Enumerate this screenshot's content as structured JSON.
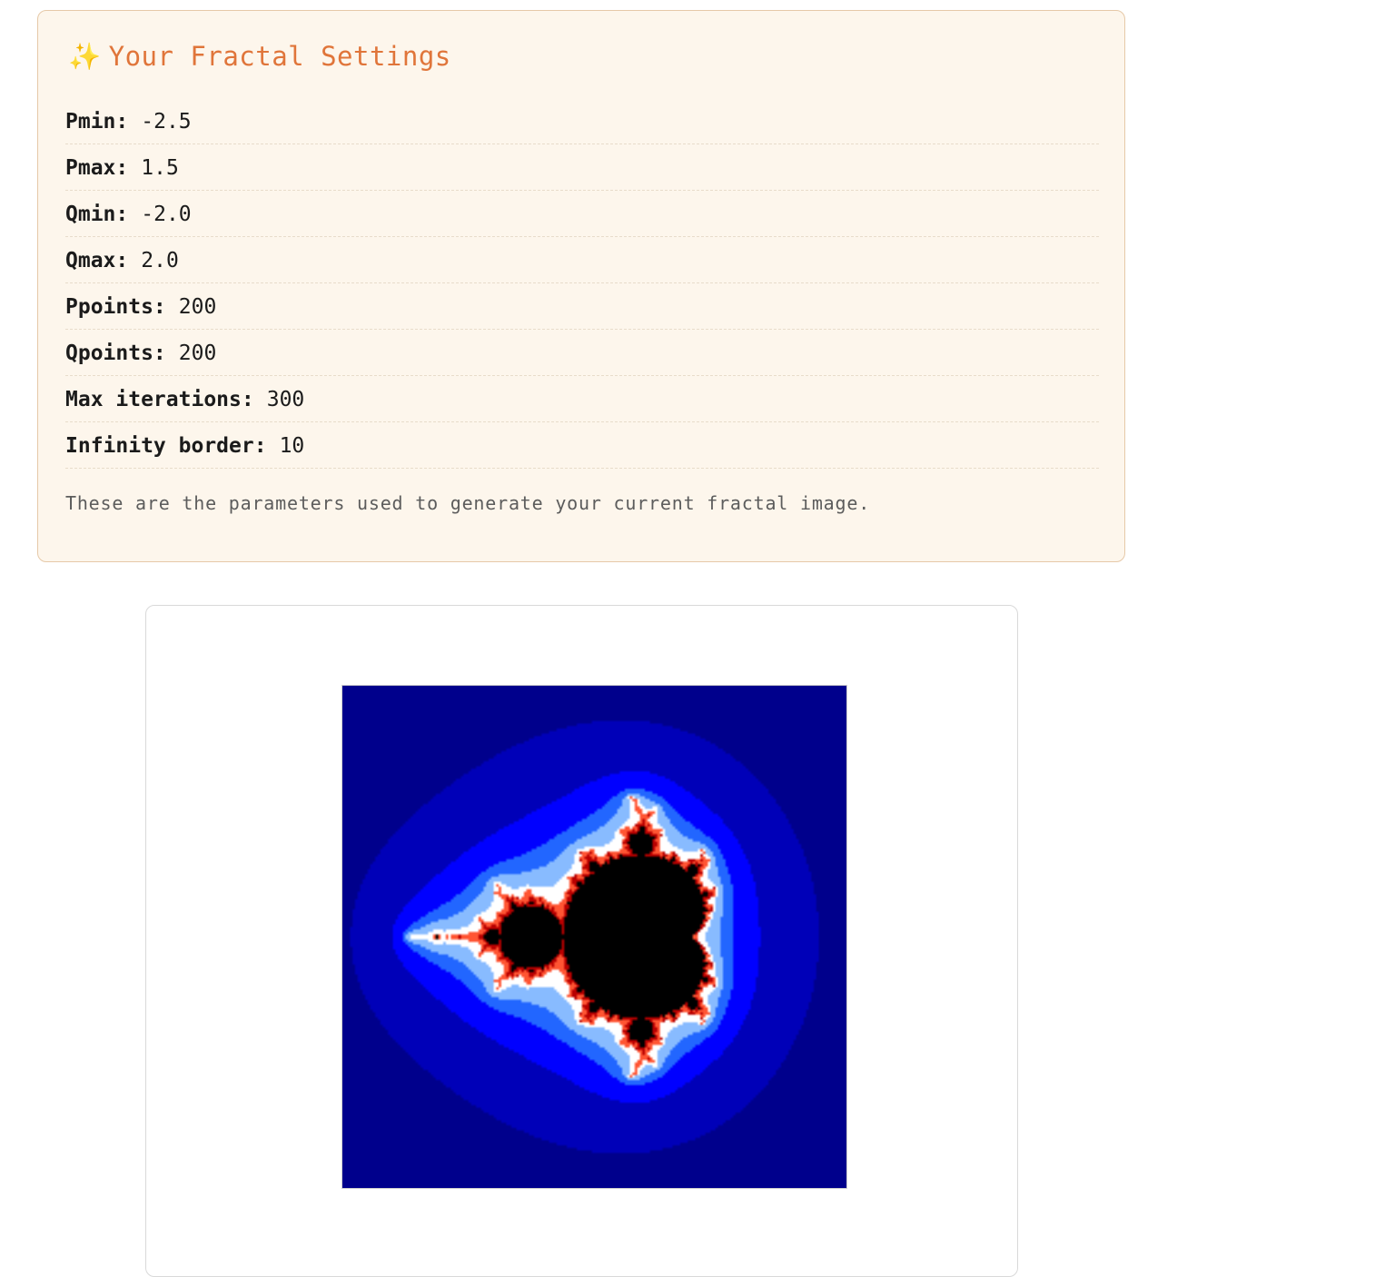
{
  "settings": {
    "sparkle_icon": "✨",
    "title": "Your Fractal Settings",
    "params": [
      {
        "label": "Pmin:",
        "value": "-2.5"
      },
      {
        "label": "Pmax:",
        "value": "1.5"
      },
      {
        "label": "Qmin:",
        "value": "-2.0"
      },
      {
        "label": "Qmax:",
        "value": "2.0"
      },
      {
        "label": "Ppoints:",
        "value": "200"
      },
      {
        "label": "Qpoints:",
        "value": "200"
      },
      {
        "label": "Max iterations:",
        "value": "300"
      },
      {
        "label": "Infinity border:",
        "value": "10"
      }
    ],
    "note": "These are the parameters used to generate your current fractal image."
  },
  "fractal": {
    "pmin": -2.5,
    "pmax": 1.5,
    "qmin": -2.0,
    "qmax": 2.0,
    "ppoints": 200,
    "qpoints": 200,
    "max_iterations": 300,
    "infinity_border": 10,
    "colors": {
      "inside": "#000000",
      "bands": [
        "#000033",
        "#00008c",
        "#0000b8",
        "#0000ff",
        "#2266ff",
        "#88bbff",
        "#ffffff",
        "#ff5533",
        "#b80000"
      ]
    }
  }
}
